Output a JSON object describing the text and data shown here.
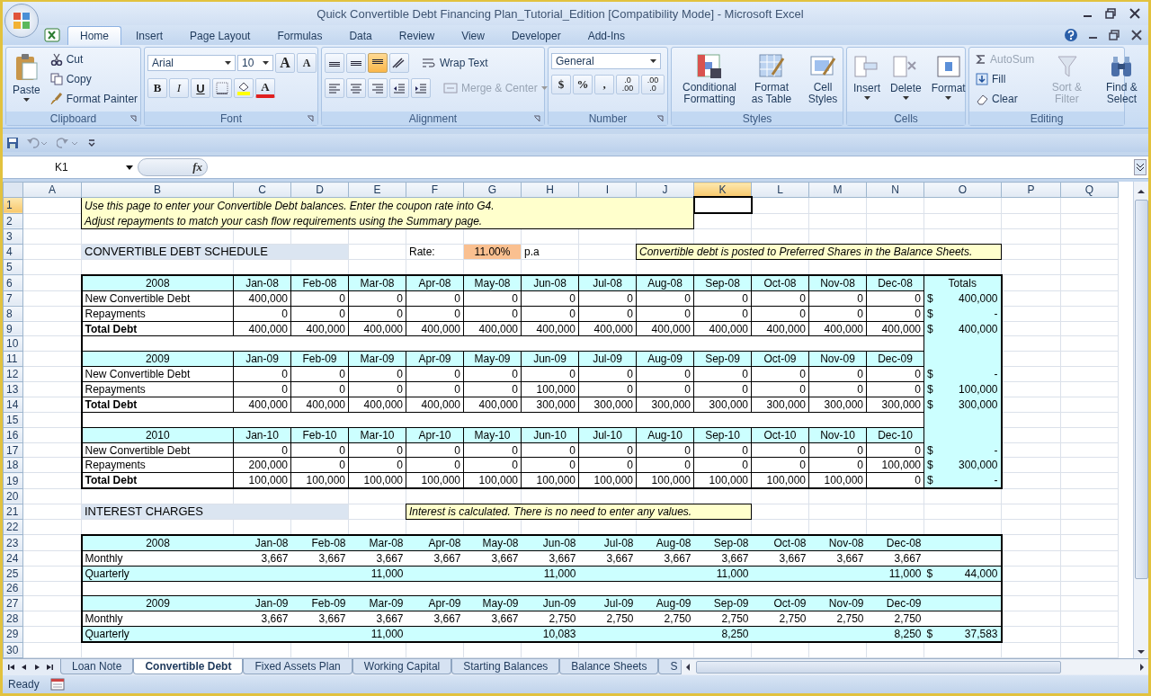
{
  "window": {
    "title": "Quick Convertible Debt Financing Plan_Tutorial_Edition  [Compatibility Mode] - Microsoft Excel"
  },
  "ribbon_tabs": [
    {
      "label": "Home",
      "selected": true
    },
    {
      "label": "Insert",
      "selected": false
    },
    {
      "label": "Page Layout",
      "selected": false
    },
    {
      "label": "Formulas",
      "selected": false
    },
    {
      "label": "Data",
      "selected": false
    },
    {
      "label": "Review",
      "selected": false
    },
    {
      "label": "View",
      "selected": false
    },
    {
      "label": "Developer",
      "selected": false
    },
    {
      "label": "Add-Ins",
      "selected": false
    }
  ],
  "ribbon": {
    "clipboard": {
      "label": "Clipboard",
      "paste": "Paste",
      "cut": "Cut",
      "copy": "Copy",
      "format_painter": "Format Painter"
    },
    "font": {
      "label": "Font",
      "font_name": "Arial",
      "font_size": "10",
      "grow": "A",
      "shrink": "A",
      "bold": "B",
      "italic": "I",
      "underline": "U",
      "font_color": "A"
    },
    "alignment": {
      "label": "Alignment",
      "vertical_align": [
        {
          "selected": false
        },
        {
          "selected": false
        },
        {
          "selected": true
        }
      ],
      "wrap_text": "Wrap Text",
      "merge_center": {
        "label": "Merge & Center",
        "disabled": true
      }
    },
    "number": {
      "label": "Number",
      "format": "General",
      "currency": "$",
      "percent": "%",
      "comma": ",",
      "increase_decimal": {
        "top": ".0",
        "bottom": ".00"
      },
      "decrease_decimal": {
        "top": ".00",
        "bottom": ".0"
      }
    },
    "styles": {
      "label": "Styles",
      "conditional": "Conditional Formatting",
      "format_table": "Format as Table",
      "cell_styles": "Cell Styles"
    },
    "cells": {
      "label": "Cells",
      "insert": "Insert",
      "delete": "Delete",
      "format": "Format"
    },
    "editing": {
      "label": "Editing",
      "autosum": {
        "label": "AutoSum",
        "disabled": true
      },
      "fill": "Fill",
      "clear": "Clear",
      "sort_filter": {
        "label": "Sort & Filter",
        "disabled": true
      },
      "find_select": "Find & Select"
    }
  },
  "quick_access": {
    "undo_disabled": true,
    "redo_disabled": true
  },
  "formula_bar": {
    "name_box": "K1",
    "function_button": "fx"
  },
  "sheet": {
    "columns": [
      {
        "letter": "A",
        "selected": false
      },
      {
        "letter": "B",
        "selected": false
      },
      {
        "letter": "C",
        "selected": false
      },
      {
        "letter": "D",
        "selected": false
      },
      {
        "letter": "E",
        "selected": false
      },
      {
        "letter": "F",
        "selected": false
      },
      {
        "letter": "G",
        "selected": false
      },
      {
        "letter": "H",
        "selected": false
      },
      {
        "letter": "I",
        "selected": false
      },
      {
        "letter": "J",
        "selected": false
      },
      {
        "letter": "K",
        "selected": true
      },
      {
        "letter": "L",
        "selected": false
      },
      {
        "letter": "M",
        "selected": false
      },
      {
        "letter": "N",
        "selected": false
      },
      {
        "letter": "O",
        "selected": false
      },
      {
        "letter": "P",
        "selected": false
      },
      {
        "letter": "Q",
        "selected": false
      }
    ],
    "rows": [
      {
        "number": "1",
        "selected": true,
        "kind": "note",
        "text": "Use this page to enter your Convertible Debt balances. Enter the coupon rate into G4."
      },
      {
        "number": "2",
        "selected": false,
        "kind": "note",
        "text": "Adjust repayments to match your cash flow requirements using the Summary page."
      },
      {
        "number": "3",
        "selected": false,
        "kind": "blank"
      },
      {
        "number": "4",
        "selected": false,
        "kind": "schedule-title",
        "title": "CONVERTIBLE DEBT SCHEDULE",
        "rate_label": "Rate:",
        "rate": "11.00%",
        "rate_unit": "p.a",
        "note": "Convertible debt is posted to Preferred Shares in the Balance Sheets."
      },
      {
        "number": "5",
        "selected": false,
        "kind": "blank"
      },
      {
        "number": "6",
        "selected": false,
        "kind": "year-header",
        "label": "2008",
        "values": [
          "Jan-08",
          "Feb-08",
          "Mar-08",
          "Apr-08",
          "May-08",
          "Jun-08",
          "Jul-08",
          "Aug-08",
          "Sep-08",
          "Oct-08",
          "Nov-08",
          "Dec-08"
        ],
        "total": {
          "text": "Totals"
        }
      },
      {
        "number": "7",
        "selected": false,
        "kind": "line",
        "label": "New Convertible Debt",
        "values": [
          "400,000",
          "0",
          "0",
          "0",
          "0",
          "0",
          "0",
          "0",
          "0",
          "0",
          "0",
          "0"
        ],
        "total": {
          "symbol": "$",
          "text": "400,000"
        }
      },
      {
        "number": "8",
        "selected": false,
        "kind": "line",
        "label": "Repayments",
        "values": [
          "0",
          "0",
          "0",
          "0",
          "0",
          "0",
          "0",
          "0",
          "0",
          "0",
          "0",
          "0"
        ],
        "total": {
          "symbol": "$",
          "text": "-"
        }
      },
      {
        "number": "9",
        "selected": false,
        "kind": "total",
        "label": "Total Debt",
        "values": [
          "400,000",
          "400,000",
          "400,000",
          "400,000",
          "400,000",
          "400,000",
          "400,000",
          "400,000",
          "400,000",
          "400,000",
          "400,000",
          "400,000"
        ],
        "total": {
          "symbol": "$",
          "text": "400,000"
        }
      },
      {
        "number": "10",
        "selected": false,
        "kind": "band"
      },
      {
        "number": "11",
        "selected": false,
        "kind": "year-header",
        "label": "2009",
        "values": [
          "Jan-09",
          "Feb-09",
          "Mar-09",
          "Apr-09",
          "May-09",
          "Jun-09",
          "Jul-09",
          "Aug-09",
          "Sep-09",
          "Oct-09",
          "Nov-09",
          "Dec-09"
        ]
      },
      {
        "number": "12",
        "selected": false,
        "kind": "line",
        "label": "New Convertible Debt",
        "values": [
          "0",
          "0",
          "0",
          "0",
          "0",
          "0",
          "0",
          "0",
          "0",
          "0",
          "0",
          "0"
        ],
        "total": {
          "symbol": "$",
          "text": "-"
        }
      },
      {
        "number": "13",
        "selected": false,
        "kind": "line",
        "label": "Repayments",
        "values": [
          "0",
          "0",
          "0",
          "0",
          "0",
          "100,000",
          "0",
          "0",
          "0",
          "0",
          "0",
          "0"
        ],
        "total": {
          "symbol": "$",
          "text": "100,000"
        }
      },
      {
        "number": "14",
        "selected": false,
        "kind": "total",
        "label": "Total Debt",
        "values": [
          "400,000",
          "400,000",
          "400,000",
          "400,000",
          "400,000",
          "300,000",
          "300,000",
          "300,000",
          "300,000",
          "300,000",
          "300,000",
          "300,000"
        ],
        "total": {
          "symbol": "$",
          "text": "300,000"
        }
      },
      {
        "number": "15",
        "selected": false,
        "kind": "band"
      },
      {
        "number": "16",
        "selected": false,
        "kind": "year-header",
        "label": "2010",
        "values": [
          "Jan-10",
          "Feb-10",
          "Mar-10",
          "Apr-10",
          "May-10",
          "Jun-10",
          "Jul-10",
          "Aug-10",
          "Sep-10",
          "Oct-10",
          "Nov-10",
          "Dec-10"
        ]
      },
      {
        "number": "17",
        "selected": false,
        "kind": "line",
        "label": "New Convertible Debt",
        "values": [
          "0",
          "0",
          "0",
          "0",
          "0",
          "0",
          "0",
          "0",
          "0",
          "0",
          "0",
          "0"
        ],
        "total": {
          "symbol": "$",
          "text": "-"
        }
      },
      {
        "number": "18",
        "selected": false,
        "kind": "line",
        "label": "Repayments",
        "values": [
          "200,000",
          "0",
          "0",
          "0",
          "0",
          "0",
          "0",
          "0",
          "0",
          "0",
          "0",
          "100,000"
        ],
        "total": {
          "symbol": "$",
          "text": "300,000"
        }
      },
      {
        "number": "19",
        "selected": false,
        "kind": "total",
        "label": "Total Debt",
        "values": [
          "100,000",
          "100,000",
          "100,000",
          "100,000",
          "100,000",
          "100,000",
          "100,000",
          "100,000",
          "100,000",
          "100,000",
          "100,000",
          "0"
        ],
        "total": {
          "symbol": "$",
          "text": "-"
        }
      },
      {
        "number": "20",
        "selected": false,
        "kind": "blank"
      },
      {
        "number": "21",
        "selected": false,
        "kind": "section-title",
        "title": "INTEREST CHARGES",
        "note": "Interest is calculated. There is no need to enter any values."
      },
      {
        "number": "22",
        "selected": false,
        "kind": "blank"
      },
      {
        "number": "23",
        "selected": false,
        "kind": "int-header",
        "label": "2008",
        "values": [
          "Jan-08",
          "Feb-08",
          "Mar-08",
          "Apr-08",
          "May-08",
          "Jun-08",
          "Jul-08",
          "Aug-08",
          "Sep-08",
          "Oct-08",
          "Nov-08",
          "Dec-08"
        ]
      },
      {
        "number": "24",
        "selected": false,
        "kind": "int-line",
        "label": "Monthly",
        "values": [
          "3,667",
          "3,667",
          "3,667",
          "3,667",
          "3,667",
          "3,667",
          "3,667",
          "3,667",
          "3,667",
          "3,667",
          "3,667",
          "3,667"
        ]
      },
      {
        "number": "25",
        "selected": false,
        "kind": "int-quarter",
        "label": "Quarterly",
        "quarters": [
          "11,000",
          "11,000",
          "11,000",
          "11,000"
        ],
        "total": {
          "symbol": "$",
          "text": "44,000"
        }
      },
      {
        "number": "26",
        "selected": false,
        "kind": "int-band"
      },
      {
        "number": "27",
        "selected": false,
        "kind": "int-header",
        "label": "2009",
        "values": [
          "Jan-09",
          "Feb-09",
          "Mar-09",
          "Apr-09",
          "May-09",
          "Jun-09",
          "Jul-09",
          "Aug-09",
          "Sep-09",
          "Oct-09",
          "Nov-09",
          "Dec-09"
        ]
      },
      {
        "number": "28",
        "selected": false,
        "kind": "int-line",
        "label": "Monthly",
        "values": [
          "3,667",
          "3,667",
          "3,667",
          "3,667",
          "3,667",
          "2,750",
          "2,750",
          "2,750",
          "2,750",
          "2,750",
          "2,750",
          "2,750"
        ]
      },
      {
        "number": "29",
        "selected": false,
        "kind": "int-quarter",
        "label": "Quarterly",
        "quarters": [
          "11,000",
          "10,083",
          "8,250",
          "8,250"
        ],
        "total": {
          "symbol": "$",
          "text": "37,583"
        }
      },
      {
        "number": "30",
        "selected": false,
        "kind": "blank"
      }
    ]
  },
  "sheet_tabs": [
    {
      "label": "Loan Note",
      "selected": false
    },
    {
      "label": "Convertible Debt",
      "selected": true
    },
    {
      "label": "Fixed Assets Plan",
      "selected": false
    },
    {
      "label": "Working Capital",
      "selected": false
    },
    {
      "label": "Starting Balances",
      "selected": false
    },
    {
      "label": "Balance Sheets",
      "selected": false
    },
    {
      "label": "S",
      "selected": false
    }
  ],
  "status_bar": {
    "text": "Ready"
  }
}
